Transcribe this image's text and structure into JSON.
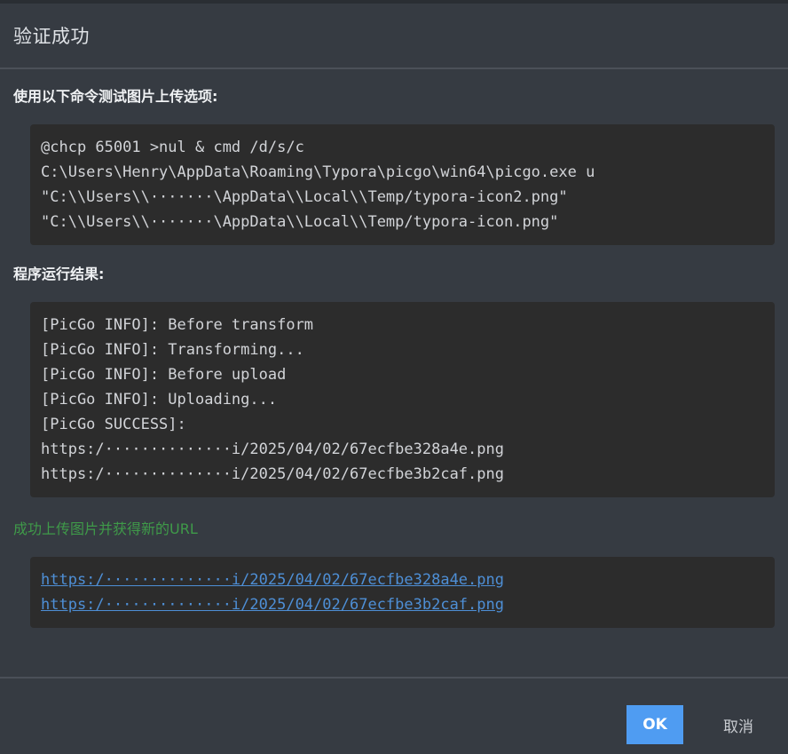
{
  "dialog": {
    "title": "验证成功",
    "command_label": "使用以下命令测试图片上传选项:",
    "command_lines": [
      "@chcp 65001 >nul & cmd /d/s/c",
      "C:\\Users\\Henry\\AppData\\Roaming\\Typora\\picgo\\win64\\picgo.exe u",
      "\"C:\\\\Users\\\\·······\\AppData\\\\Local\\\\Temp/typora-icon2.png\"",
      "\"C:\\\\Users\\\\·······\\AppData\\\\Local\\\\Temp/typora-icon.png\""
    ],
    "result_label": "程序运行结果:",
    "result_lines": [
      "[PicGo INFO]: Before transform",
      "[PicGo INFO]: Transforming...",
      "[PicGo INFO]: Before upload",
      "[PicGo INFO]: Uploading...",
      "[PicGo SUCCESS]:",
      "https:/··············i/2025/04/02/67ecfbe328a4e.png",
      "https:/··············i/2025/04/02/67ecfbe3b2caf.png"
    ],
    "success_message": "成功上传图片并获得新的URL",
    "urls": [
      "https:/··············i/2025/04/02/67ecfbe328a4e.png",
      "https:/··············i/2025/04/02/67ecfbe3b2caf.png"
    ],
    "ok_label": "OK",
    "cancel_label": "取消"
  },
  "colors": {
    "background": "#363b42",
    "code_background": "#2c2c2c",
    "success_green": "#3f9a49",
    "link_blue": "#4e8fd6",
    "ok_button": "#4f9cf2"
  }
}
